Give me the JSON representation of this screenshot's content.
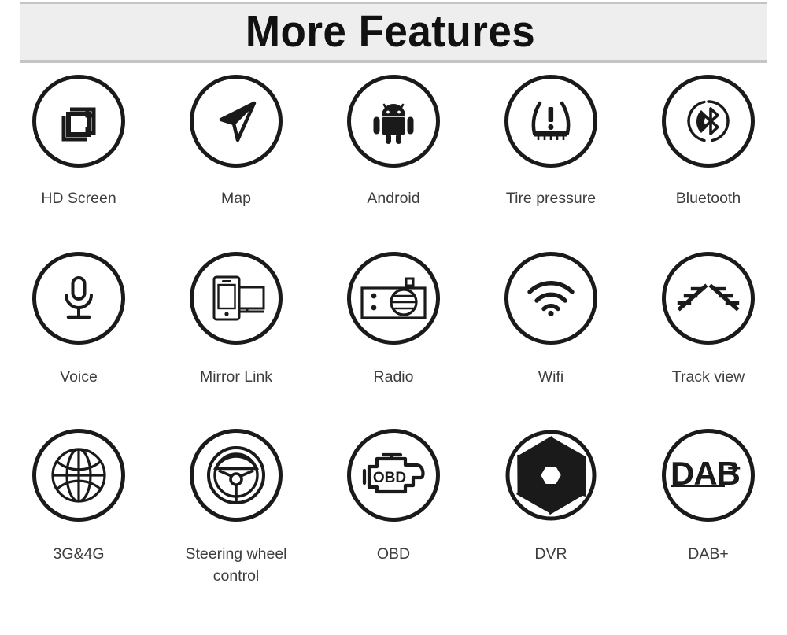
{
  "header": {
    "title": "More Features",
    "band_color": "#eeeeee",
    "band_border_color": "#c4c4c4",
    "title_color": "#111111"
  },
  "theme": {
    "background": "#ffffff",
    "icon_stroke": "#1a1a1a",
    "label_color": "#3d3d3d"
  },
  "features": [
    {
      "label": "HD Screen",
      "icon": "hd-screen-icon"
    },
    {
      "label": "Map",
      "icon": "navigation-arrow-icon"
    },
    {
      "label": "Android",
      "icon": "android-robot-icon"
    },
    {
      "label": "Tire pressure",
      "icon": "tire-pressure-warning-icon"
    },
    {
      "label": "Bluetooth",
      "icon": "bluetooth-phone-icon"
    },
    {
      "label": "Voice",
      "icon": "microphone-icon"
    },
    {
      "label": "Mirror Link",
      "icon": "phone-screen-mirror-icon"
    },
    {
      "label": "Radio",
      "icon": "radio-icon"
    },
    {
      "label": "Wifi",
      "icon": "wifi-icon"
    },
    {
      "label": "Track view",
      "icon": "parking-track-guidelines-icon"
    },
    {
      "label": "3G&4G",
      "icon": "globe-icon"
    },
    {
      "label": "Steering wheel control",
      "icon": "steering-wheel-icon"
    },
    {
      "label": "OBD",
      "icon": "engine-obd-icon"
    },
    {
      "label": "DVR",
      "icon": "camera-aperture-icon"
    },
    {
      "label": "DAB+",
      "icon": "dab-plus-wordmark-icon"
    }
  ],
  "icon_text": {
    "obd": "OBD",
    "dab": "DAB",
    "dab_plus": "+"
  }
}
